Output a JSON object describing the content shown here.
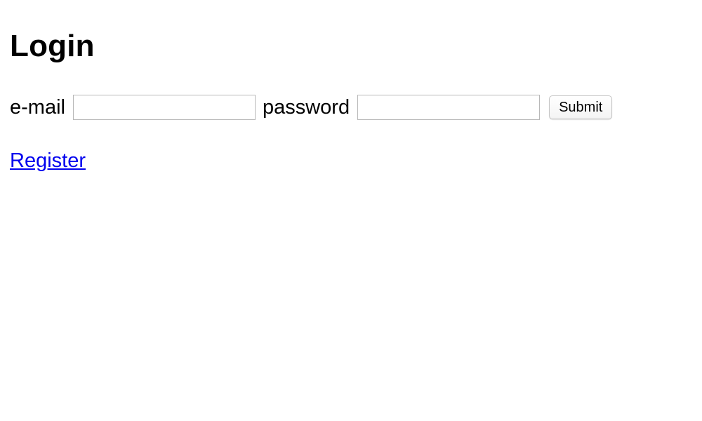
{
  "page": {
    "title": "Login"
  },
  "form": {
    "email_label": "e-mail",
    "email_value": "",
    "password_label": "password",
    "password_value": "",
    "submit_label": "Submit"
  },
  "links": {
    "register_label": "Register"
  },
  "colors": {
    "link": "#0000ee",
    "input_border": "#b8b8b8"
  }
}
